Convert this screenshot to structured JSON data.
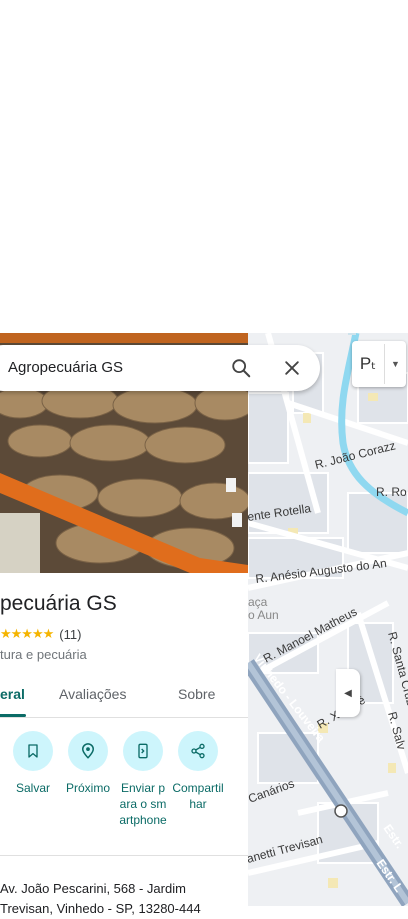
{
  "search": {
    "query": "Agropecuária GS"
  },
  "place": {
    "name": "pecuária GS",
    "rating_count": "(11)",
    "stars": "★★★★★",
    "category": "tura e pecuária"
  },
  "tabs": [
    {
      "label": "eral",
      "active": true
    },
    {
      "label": "Avaliações",
      "active": false
    },
    {
      "label": "Sobre",
      "active": false
    }
  ],
  "actions": [
    {
      "label": "Salvar",
      "icon": "bookmark-icon"
    },
    {
      "label": "Próximo",
      "icon": "nearby-icon"
    },
    {
      "label": "Enviar para o smartphone",
      "icon": "send-to-phone-icon"
    },
    {
      "label": "Compartilhar",
      "icon": "share-icon"
    }
  ],
  "address": {
    "line1": "Av. João Pescarini, 568 - Jardim",
    "line2": "Trevisan, Vinhedo - SP, 13280-444"
  },
  "map": {
    "layer_button_label": "Pₜ",
    "streets": [
      "R. João Corazz",
      "R. Ro",
      "ente Rotella",
      "R. Anésio Augusto do An",
      "aça",
      "o Aun",
      "R. Manoel Matheus",
      "R. Santa Cruz",
      "Vinhedo - Louveira",
      "R. Xaxerê",
      "R. Salv",
      "Canários",
      "Estr.",
      "anetti Trevisan",
      "Estr. L"
    ]
  },
  "colors": {
    "accent": "#0b6b66",
    "action_bg": "#cdf5fc",
    "star": "#f5b400",
    "river": "#8fd8f0",
    "highway": "#8fa4be"
  }
}
